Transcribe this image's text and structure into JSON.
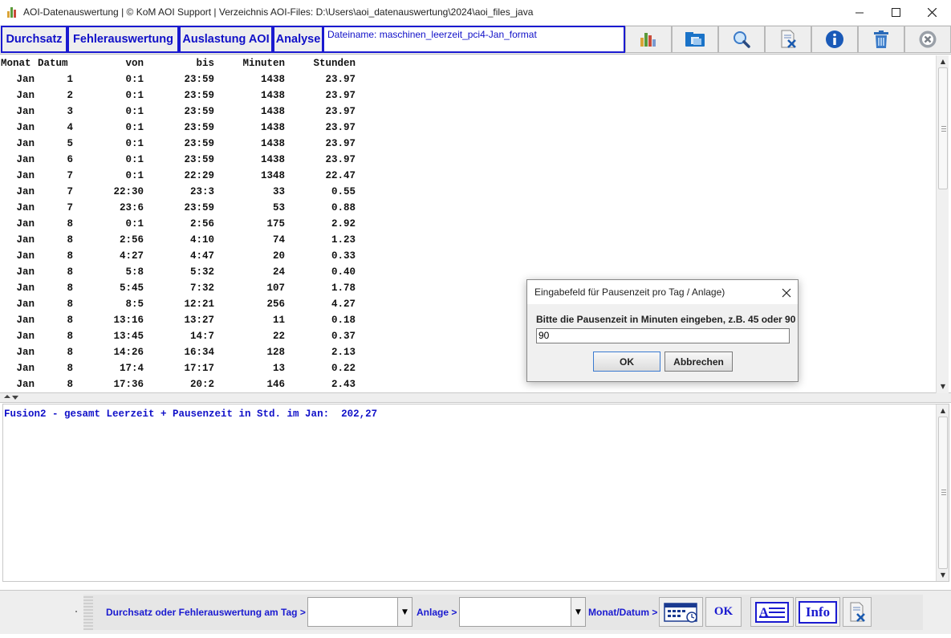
{
  "window": {
    "title": "AOI-Datenauswertung | © KoM AOI Support  | Verzeichnis AOI-Files: D:\\Users\\aoi_datenauswertung\\2024\\aoi_files_java"
  },
  "toolbar": {
    "tabs": [
      "Durchsatz",
      "Fehlerauswertung",
      "Auslastung AOI",
      "Analyse"
    ],
    "filename": "Dateiname: maschinen_leerzeit_pci4-Jan_format"
  },
  "table": {
    "headers": [
      "Monat",
      "Datum",
      "von",
      "bis",
      "Minuten",
      "Stunden"
    ],
    "rows": [
      [
        "Jan",
        "1",
        "0:1",
        "23:59",
        "1438",
        "23.97"
      ],
      [
        "Jan",
        "2",
        "0:1",
        "23:59",
        "1438",
        "23.97"
      ],
      [
        "Jan",
        "3",
        "0:1",
        "23:59",
        "1438",
        "23.97"
      ],
      [
        "Jan",
        "4",
        "0:1",
        "23:59",
        "1438",
        "23.97"
      ],
      [
        "Jan",
        "5",
        "0:1",
        "23:59",
        "1438",
        "23.97"
      ],
      [
        "Jan",
        "6",
        "0:1",
        "23:59",
        "1438",
        "23.97"
      ],
      [
        "Jan",
        "7",
        "0:1",
        "22:29",
        "1348",
        "22.47"
      ],
      [
        "Jan",
        "7",
        "22:30",
        "23:3",
        "33",
        "0.55"
      ],
      [
        "Jan",
        "7",
        "23:6",
        "23:59",
        "53",
        "0.88"
      ],
      [
        "Jan",
        "8",
        "0:1",
        "2:56",
        "175",
        "2.92"
      ],
      [
        "Jan",
        "8",
        "2:56",
        "4:10",
        "74",
        "1.23"
      ],
      [
        "Jan",
        "8",
        "4:27",
        "4:47",
        "20",
        "0.33"
      ],
      [
        "Jan",
        "8",
        "5:8",
        "5:32",
        "24",
        "0.40"
      ],
      [
        "Jan",
        "8",
        "5:45",
        "7:32",
        "107",
        "1.78"
      ],
      [
        "Jan",
        "8",
        "8:5",
        "12:21",
        "256",
        "4.27"
      ],
      [
        "Jan",
        "8",
        "13:16",
        "13:27",
        "11",
        "0.18"
      ],
      [
        "Jan",
        "8",
        "13:45",
        "14:7",
        "22",
        "0.37"
      ],
      [
        "Jan",
        "8",
        "14:26",
        "16:34",
        "128",
        "2.13"
      ],
      [
        "Jan",
        "8",
        "17:4",
        "17:17",
        "13",
        "0.22"
      ],
      [
        "Jan",
        "8",
        "17:36",
        "20:2",
        "146",
        "2.43"
      ]
    ]
  },
  "result": {
    "text": "Fusion2 - gesamt Leerzeit + Pausenzeit in Std. im Jan:  202,27"
  },
  "bottombar": {
    "label_day": "Durchsatz oder Fehlerauswertung am Tag >",
    "label_anlage": "Anlage >",
    "label_monat": "Monat/Datum >",
    "ok_label": "OK",
    "info_label": "Info"
  },
  "dialog": {
    "title": "Eingabefeld für Pausenzeit pro Tag / Anlage)",
    "message": "Bitte die Pausenzeit in Minuten eingeben, z.B. 45 oder 90",
    "input_value": "90",
    "ok_label": "OK",
    "cancel_label": "Abbrechen"
  },
  "colors": {
    "accent": "#1010c8"
  }
}
